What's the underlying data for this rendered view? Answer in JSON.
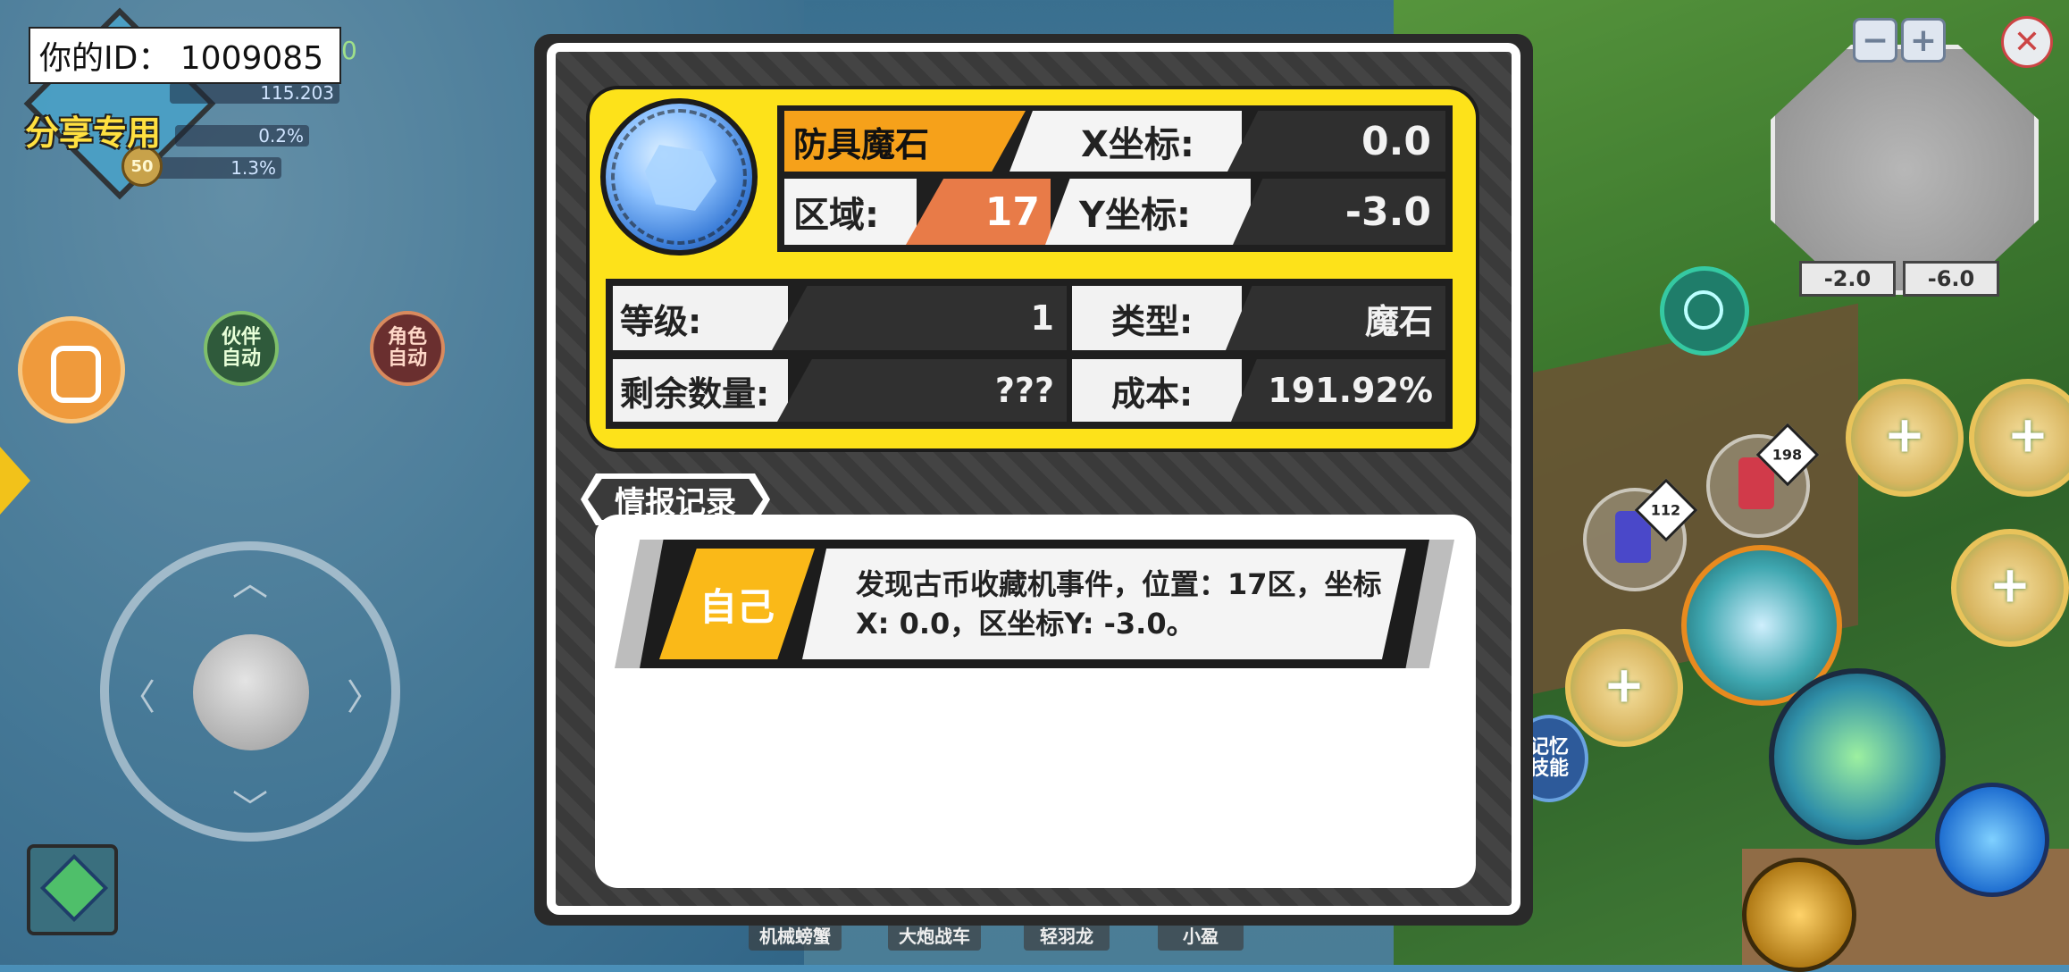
{
  "hud": {
    "player_id_text": "你的ID： 1009085",
    "share_label": "分享专用",
    "top_number": "115.203",
    "stat_1": "0.2%",
    "stat_2": "1.3%",
    "level_badge": "50",
    "partner_auto": "伙伴\n自动",
    "role_auto": "角色\n自动",
    "memory_skill": "记忆\n技能",
    "corner_num": "0"
  },
  "minimap": {
    "zoom_out": "−",
    "zoom_in": "+",
    "coord_x": "-2.0",
    "coord_y": "-6.0"
  },
  "potions": {
    "blue_count": "112",
    "red_count": "198"
  },
  "bottom_tabs": [
    "机械螃蟹",
    "大炮战车",
    "轻羽龙",
    "小盈"
  ],
  "panel": {
    "item_name": "防具魔石",
    "x_label": "X坐标:",
    "x_value": "0.0",
    "region_label": "区域:",
    "region_value": "17",
    "y_label": "Y坐标:",
    "y_value": "-3.0",
    "level_label": "等级:",
    "level_value": "1",
    "type_label": "类型:",
    "type_value": "魔石",
    "remaining_label": "剩余数量:",
    "remaining_value": "???",
    "cost_label": "成本:",
    "cost_value": "191.92%",
    "log_title": "情报记录",
    "log_entries": [
      {
        "who": "自己",
        "text": "发现古币收藏机事件，位置：17区，坐标X: 0.0，区坐标Y: -3.0。"
      }
    ]
  },
  "colors": {
    "card_yellow": "#fde21a",
    "name_orange": "#f6a11a",
    "region_orange": "#e87b48",
    "log_who_yellow": "#fab918",
    "panel_dark": "#3a3a3a"
  }
}
